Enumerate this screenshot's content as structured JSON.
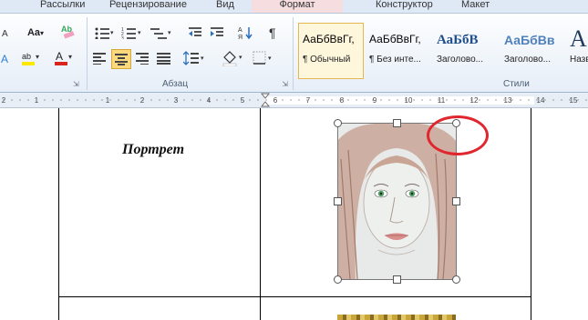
{
  "tabs": [
    "Рассылки",
    "Рецензирование",
    "Вид",
    "Формат",
    "Конструктор",
    "Макет"
  ],
  "groups": {
    "paragraph": "Абзац",
    "styles": "Стили"
  },
  "font_group": {
    "size_label": "Aa"
  },
  "styles": [
    {
      "sample": "АаБбВвГг,",
      "name": "¶ Обычный"
    },
    {
      "sample": "АаБбВвГг,",
      "name": "¶ Без инте..."
    },
    {
      "sample": "АаБбВ",
      "name": "Заголово..."
    },
    {
      "sample": "АаБбВв",
      "name": "Заголово..."
    },
    {
      "sample": "А",
      "name": "Назв"
    }
  ],
  "ruler_numbers": [
    "2",
    "1",
    "1",
    "2",
    "3",
    "4",
    "5",
    "6",
    "7",
    "8",
    "9",
    "10",
    "11",
    "12",
    "13",
    "14",
    "15",
    "16"
  ],
  "table": {
    "cell_text": "Портрет"
  },
  "colors": {
    "accent_red": "#e0262e",
    "highlight_yellow": "#ffe800",
    "font_red": "#d8261e"
  }
}
